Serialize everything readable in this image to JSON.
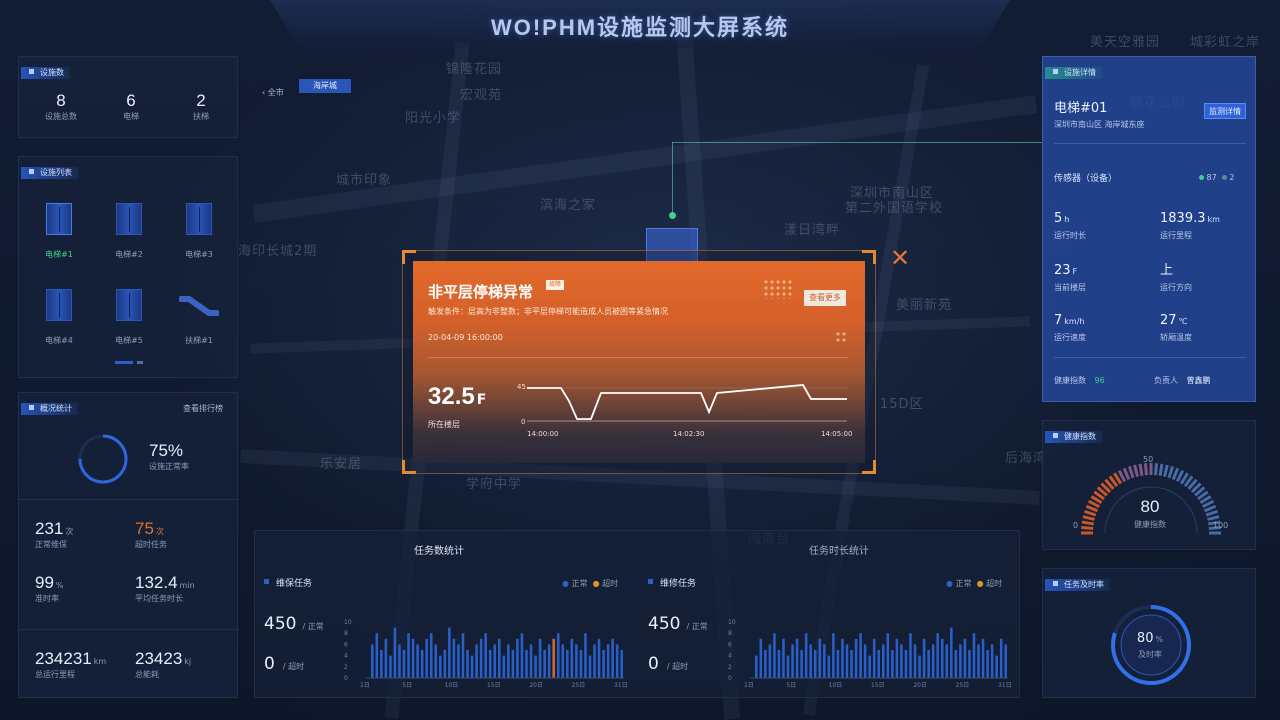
{
  "header": {
    "title": "WO!PHM设施监测大屏系统"
  },
  "map_labels": [
    "美天空雅园",
    "城彩虹之岸",
    "锦隆花园",
    "宏观苑",
    "阳光小学",
    "桃花公园",
    "深圳市南山区",
    "第二外国语学校",
    "城市印象",
    "滨海之家",
    "漾日湾畔",
    "海印长城2期",
    "乐安居",
    "学府中学",
    "湾海台",
    "后海湾",
    "美丽新苑",
    "15D区"
  ],
  "breadcrumb": {
    "back": "全市",
    "current": "海岸城"
  },
  "facility_count": {
    "title": "设施数",
    "items": [
      {
        "value": "8",
        "label": "设施总数"
      },
      {
        "value": "6",
        "label": "电梯"
      },
      {
        "value": "2",
        "label": "扶梯"
      }
    ]
  },
  "facility_list": {
    "title": "设施列表",
    "items": [
      {
        "label": "电梯#1",
        "active": true,
        "icon": "elevator-icon"
      },
      {
        "label": "电梯#2",
        "active": false,
        "icon": "elevator-icon"
      },
      {
        "label": "电梯#3",
        "active": false,
        "icon": "elevator-icon"
      },
      {
        "label": "电梯#4",
        "active": false,
        "icon": "elevator-icon"
      },
      {
        "label": "电梯#5",
        "active": false,
        "icon": "elevator-icon"
      },
      {
        "label": "扶梯#1",
        "active": false,
        "icon": "escalator-icon"
      }
    ]
  },
  "overview": {
    "title": "概况统计",
    "link": "查看排行榜",
    "rate_value": "75%",
    "rate_label": "设施正常率",
    "rate_fraction": 0.75,
    "stats": [
      {
        "value": "231",
        "unit": "次",
        "label": "正常维保",
        "warn": false
      },
      {
        "value": "75",
        "unit": "次",
        "label": "超时任务",
        "warn": true
      },
      {
        "value": "99",
        "unit": "%",
        "label": "准时率",
        "warn": false
      },
      {
        "value": "132.4",
        "unit": "min",
        "label": "平均任务时长",
        "warn": false
      },
      {
        "value": "234231",
        "unit": "km",
        "label": "总运行里程",
        "warn": false
      },
      {
        "value": "23423",
        "unit": "kj",
        "label": "总能耗",
        "warn": false
      }
    ]
  },
  "task_count": {
    "title": "任务数统计",
    "sub": "维保任务",
    "legend_normal": "正常",
    "legend_timeout": "超时",
    "normal_value": "450",
    "normal_label": "/ 正常",
    "timeout_value": "0",
    "timeout_label": "/ 超时",
    "y_ticks": [
      "10",
      "8",
      "6",
      "4",
      "2",
      "0"
    ],
    "x_ticks": [
      "1日",
      "5日",
      "10日",
      "15日",
      "20日",
      "25日",
      "31日"
    ],
    "values": [
      6,
      8,
      5,
      7,
      4,
      9,
      6,
      5,
      8,
      7,
      6,
      5,
      7,
      8,
      6,
      4,
      5,
      9,
      7,
      6,
      8,
      5,
      4,
      6,
      7,
      8,
      5,
      6,
      7,
      4,
      6,
      5,
      7,
      8,
      5,
      6,
      4,
      7,
      5,
      6,
      7,
      8,
      6,
      5,
      7,
      6,
      5,
      8,
      4,
      6,
      7,
      5,
      6,
      7,
      6,
      5
    ]
  },
  "task_duration": {
    "title": "任务时长统计",
    "sub": "维修任务",
    "legend_normal": "正常",
    "legend_timeout": "超时",
    "normal_value": "450",
    "normal_label": "/ 正常",
    "timeout_value": "0",
    "timeout_label": "/ 超时",
    "y_ticks": [
      "10",
      "8",
      "6",
      "4",
      "2",
      "0"
    ],
    "x_ticks": [
      "1日",
      "5日",
      "10日",
      "15日",
      "20日",
      "25日",
      "31日"
    ],
    "values": [
      4,
      7,
      5,
      6,
      8,
      5,
      7,
      4,
      6,
      7,
      5,
      8,
      6,
      5,
      7,
      6,
      4,
      8,
      5,
      7,
      6,
      5,
      7,
      8,
      6,
      4,
      7,
      5,
      6,
      8,
      5,
      7,
      6,
      5,
      8,
      6,
      4,
      7,
      5,
      6,
      8,
      7,
      6,
      9,
      5,
      6,
      7,
      5,
      8,
      6,
      7,
      5,
      6,
      4,
      7,
      6
    ]
  },
  "alert": {
    "title": "非平层停梯异常",
    "badge": "故障",
    "condition": "触发条件：层高为非整数；非平层停梯可能造成人员被困等紧急情况",
    "time": "20-04-09 16:00:00",
    "button": "查看更多",
    "value": "32.5",
    "unit": "F",
    "value_label": "所在楼层",
    "chart": {
      "y_max": "45",
      "y_min": "0",
      "x_ticks": [
        "14:00:00",
        "14:02:30",
        "14:05:00"
      ]
    }
  },
  "facility_detail": {
    "title": "设施详情",
    "name": "电梯#01",
    "address": "深圳市南山区 海岸城东座",
    "button": "监测详情",
    "sensor_label": "传感器（设备）",
    "sensor_ok": "87",
    "sensor_off": "2",
    "metrics": [
      {
        "value": "5",
        "unit": "h",
        "label": "运行时长"
      },
      {
        "value": "1839.3",
        "unit": "km",
        "label": "运行里程"
      },
      {
        "value": "23",
        "unit": "F",
        "label": "当前楼层"
      },
      {
        "value": "上",
        "unit": "",
        "label": "运行方向"
      },
      {
        "value": "7",
        "unit": "km/h",
        "label": "运行速度"
      },
      {
        "value": "27",
        "unit": "℃",
        "label": "轿厢温度"
      }
    ],
    "health_label": "健康指数",
    "health_value": "96",
    "owner_label": "负责人",
    "owner_value": "曾鑫鹏"
  },
  "health": {
    "title": "健康指数",
    "value": "80",
    "label": "健康指数",
    "min": "0",
    "mid": "50",
    "max": "100"
  },
  "ontime": {
    "title": "任务及时率",
    "value": "80",
    "unit": "%",
    "label": "及时率",
    "fraction": 0.8
  },
  "colors": {
    "accent": "#2a5fc8",
    "warn": "#e0702a",
    "ok": "#3fd08c"
  }
}
